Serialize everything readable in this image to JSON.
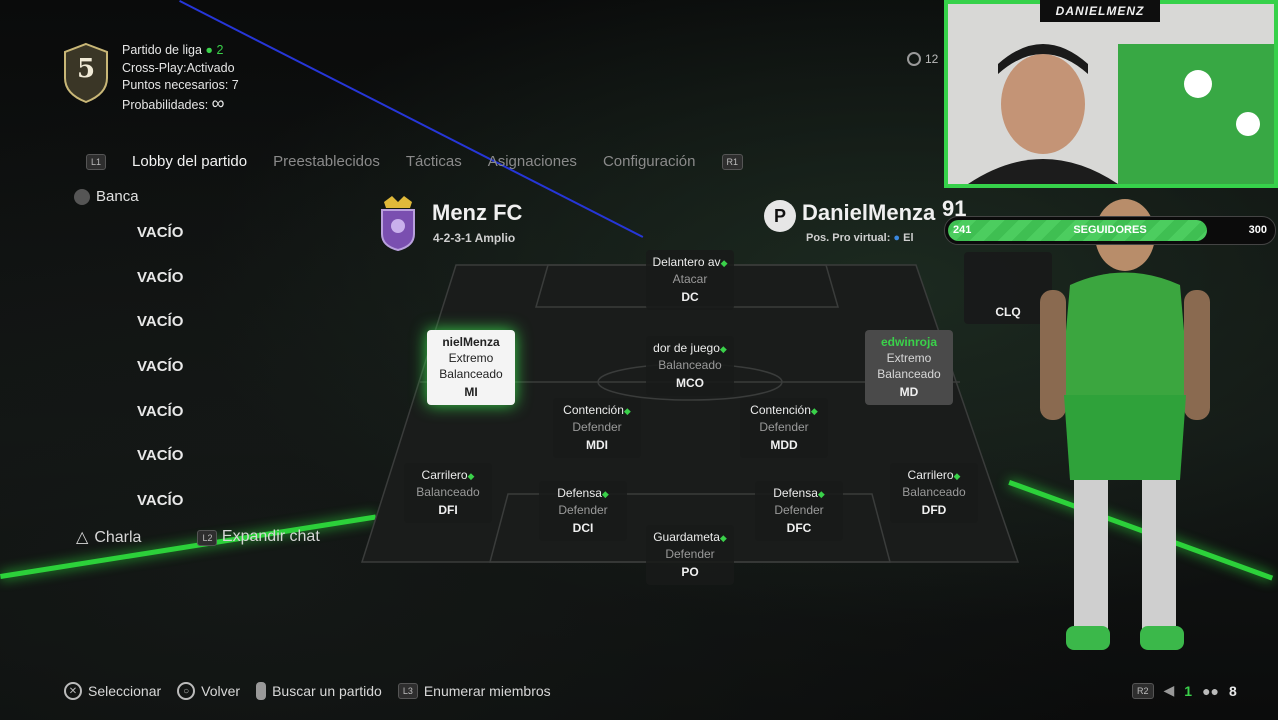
{
  "league": {
    "rank": "5",
    "line1": "Partido de liga",
    "players_online": "2",
    "line2": "Cross-Play:Activado",
    "line3": "Puntos necesarios: 7",
    "line4": "Probabilidades:",
    "odds_symbol": "∞"
  },
  "tabs": {
    "left_btn": "L1",
    "right_btn": "R1",
    "items": [
      "Lobby del partido",
      "Preestablecidos",
      "Tácticas",
      "Asignaciones",
      "Configuración"
    ]
  },
  "bench": {
    "title": "Banca",
    "items": [
      "VACÍO",
      "VACÍO",
      "VACÍO",
      "VACÍO",
      "VACÍO",
      "VACÍO",
      "VACÍO"
    ]
  },
  "chat": {
    "talk_label": "Charla",
    "expand_label": "Expandir chat",
    "expand_btn": "L2"
  },
  "team": {
    "name": "Menz FC",
    "formation": "4-2-3-1 Amplio"
  },
  "player": {
    "name": "DanielMenza",
    "pro_virtual": "Pos. Pro virtual:",
    "pro_virtual_value": "El",
    "rating": "91",
    "coins": "12"
  },
  "pitch": {
    "slots": [
      {
        "role": "Delantero av",
        "style": "Atacar",
        "pos": "DC",
        "variant": ""
      },
      {
        "role": "dor de juego",
        "style": "Balanceado",
        "pos": "MCO",
        "variant": ""
      },
      {
        "role": "nielMenza",
        "style": "Extremo",
        "style2": "Balanceado",
        "pos": "MI",
        "variant": "white"
      },
      {
        "role": "edwinroja",
        "style": "Extremo",
        "style2": "Balanceado",
        "pos": "MD",
        "variant": "grey"
      },
      {
        "role": "Contención",
        "style": "Defender",
        "pos": "MDI",
        "variant": ""
      },
      {
        "role": "Contención",
        "style": "Defender",
        "pos": "MDD",
        "variant": ""
      },
      {
        "role": "Carrilero",
        "style": "Balanceado",
        "pos": "DFI",
        "variant": ""
      },
      {
        "role": "Defensa",
        "style": "Defender",
        "pos": "DCI",
        "variant": ""
      },
      {
        "role": "Defensa",
        "style": "Defender",
        "pos": "DFC",
        "variant": ""
      },
      {
        "role": "Carrilero",
        "style": "Balanceado",
        "pos": "DFD",
        "variant": ""
      },
      {
        "role": "Guardameta",
        "style": "Defender",
        "pos": "PO",
        "variant": ""
      },
      {
        "role": "",
        "style": "",
        "pos": "CLQ",
        "variant": "empty"
      }
    ]
  },
  "stream": {
    "tag": "DANIELMENZ",
    "followers_label": "SEGUIDORES",
    "followers_current": "241",
    "followers_goal": "300",
    "followers_fraction": 0.8
  },
  "bottom_bar": {
    "items": [
      "Seleccionar",
      "Volver",
      "Buscar un partido",
      "Enumerar miembros"
    ],
    "r2": "R2",
    "count1": "1",
    "count2": "8"
  },
  "colors": {
    "accent": "#36d14a",
    "laser": "#2636d8"
  }
}
